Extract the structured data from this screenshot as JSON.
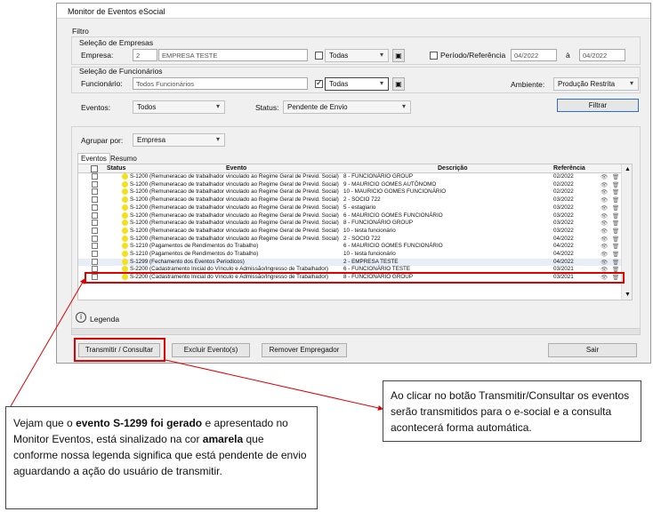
{
  "window": {
    "title": "Monitor de Eventos eSocial"
  },
  "filter": {
    "label": "Filtro",
    "company_section": "Seleção de Empresas",
    "company_label": "Empresa:",
    "company_code": "2",
    "company_name": "EMPRESA TESTE",
    "company_all_label": "Todas",
    "company_all_checked": false,
    "period_label": "Período/Referência",
    "period_checked": false,
    "period_from": "04/2022",
    "period_sep": "à",
    "period_to": "04/2022",
    "employee_section": "Seleção de Funcionários",
    "employee_label": "Funcionário:",
    "employee_value": "Todos Funcionários",
    "employee_all_label": "Todas",
    "employee_all_checked": true,
    "environment_label": "Ambiente:",
    "environment_value": "Produção Restrita",
    "events_label": "Eventos:",
    "events_value": "Todos",
    "status_label": "Status:",
    "status_value": "Pendente de Envio",
    "filter_button": "Filtrar"
  },
  "group_by": {
    "label": "Agrupar por:",
    "value": "Empresa"
  },
  "tabs": [
    {
      "label": "Eventos"
    },
    {
      "label": "Resumo"
    }
  ],
  "grid": {
    "headers": {
      "status": "Status",
      "event": "Evento",
      "description": "Descrição",
      "reference": "Referência"
    },
    "rows": [
      {
        "event": "S-1200 (Remuneracao de trabalhador vinculado ao Regime Geral de Previd. Social)",
        "description": "8 - FUNCIONÁRIO GROUP",
        "reference": "02/2022"
      },
      {
        "event": "S-1200 (Remuneracao de trabalhador vinculado ao Regime Geral de Previd. Social)",
        "description": "9 - MAURICIO GOMES AUTÔNOMO",
        "reference": "02/2022"
      },
      {
        "event": "S-1200 (Remuneracao de trabalhador vinculado ao Regime Geral de Previd. Social)",
        "description": "10 - MAURICIO GOMES FUNCIONÁRIO",
        "reference": "02/2022"
      },
      {
        "event": "S-1200 (Remuneracao de trabalhador vinculado ao Regime Geral de Previd. Social)",
        "description": "2 - SOCIO 722",
        "reference": "03/2022"
      },
      {
        "event": "S-1200 (Remuneracao de trabalhador vinculado ao Regime Geral de Previd. Social)",
        "description": "5 - estagiario",
        "reference": "03/2022"
      },
      {
        "event": "S-1200 (Remuneracao de trabalhador vinculado ao Regime Geral de Previd. Social)",
        "description": "6 - MAURICIO GOMES FUNCIONÁRIO",
        "reference": "03/2022"
      },
      {
        "event": "S-1200 (Remuneracao de trabalhador vinculado ao Regime Geral de Previd. Social)",
        "description": "8 - FUNCIONÁRIO GROUP",
        "reference": "03/2022"
      },
      {
        "event": "S-1200 (Remuneracao de trabalhador vinculado ao Regime Geral de Previd. Social)",
        "description": "10 - testa funcionário",
        "reference": "03/2022"
      },
      {
        "event": "S-1200 (Remuneracao de trabalhador vinculado ao Regime Geral de Previd. Social)",
        "description": "2 - SOCIO 722",
        "reference": "04/2022"
      },
      {
        "event": "S-1210 (Pagamentos de Rendimentos do Trabalho)",
        "description": "6 - MAURICIO GOMES FUNCIONÁRIO",
        "reference": "04/2022"
      },
      {
        "event": "S-1210 (Pagamentos de Rendimentos do Trabalho)",
        "description": "10 - testa funcionário",
        "reference": "04/2022"
      },
      {
        "event": "S-1299 (Fechamento dos Eventos Periodicos)",
        "description": "2 - EMPRESA TESTE",
        "reference": "04/2022"
      },
      {
        "event": "S-2200 (Cadastramento Inicial do Vínculo e Admissão/Ingresso de Trabalhador)",
        "description": "6 - FUNCIONÁRIO TESTE",
        "reference": "03/2021"
      },
      {
        "event": "S-2200 (Cadastramento Inicial do Vínculo e Admissão/Ingresso de Trabalhador)",
        "description": "8 - FUNCIONÁRIO GROUP",
        "reference": "03/2021"
      }
    ]
  },
  "legend": {
    "label": "Legenda"
  },
  "buttons": {
    "transmit": "Transmitir / Consultar",
    "delete": "Excluir Evento(s)",
    "remove_employer": "Remover Empregador",
    "exit": "Sair"
  },
  "annotations": {
    "left": {
      "p1": "Vejam que o ",
      "b1": "evento S-1299 foi gerado",
      "p2": " e apresentado no Monitor Eventos, está sinalizado na cor ",
      "b2": "amarela",
      "p3": " que conforme nossa legenda significa que está pendente de envio aguardando a ação do usuário de transmitir."
    },
    "right": "Ao clicar no botão Transmitir/Consultar os eventos serão transmitidos para o e-social e a consulta acontecerá forma automática."
  },
  "colors": {
    "highlight": "#e00000",
    "pending": "#f2e11b"
  }
}
